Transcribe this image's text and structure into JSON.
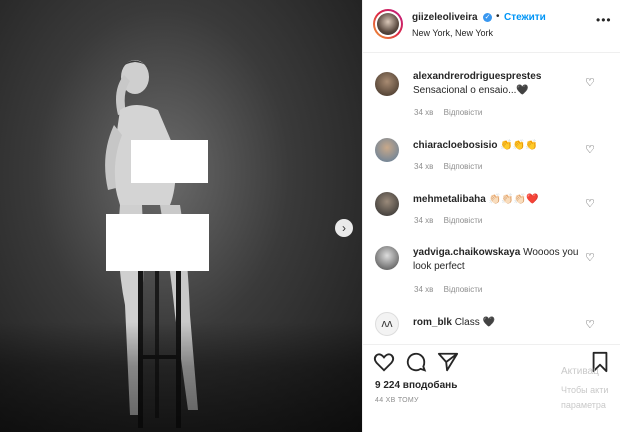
{
  "post": {
    "username": "giizeleoliveira",
    "follow_label": "Стежити",
    "location": "New York, New York",
    "more_label": "•••"
  },
  "comments": [
    {
      "username": "alexandrerodriguesprestes",
      "text": "Sensacional o ensaio...🖤",
      "time": "34 хв",
      "reply": "Відповісти"
    },
    {
      "username": "chiaracloebosisio",
      "text": "👏👏👏",
      "time": "34 хв",
      "reply": "Відповісти"
    },
    {
      "username": "mehmetalibaha",
      "text": "👏🏻👏🏻👏🏻❤️",
      "time": "34 хв",
      "reply": "Відповісти"
    },
    {
      "username": "yadviga.chaikowskaya",
      "text": "Woooos you look perfect",
      "time": "34 хв",
      "reply": "Відповісти"
    },
    {
      "username": "rom_blk",
      "text": "Class 🖤",
      "time": "",
      "reply": ""
    }
  ],
  "footer": {
    "likes": "9 224 вподобань",
    "timestamp": "44 ХВ ТОМУ"
  },
  "watermark": {
    "line1": "Активац",
    "line2": "Чтобы акти",
    "line3": "параметра"
  },
  "colors": {
    "accent": "#0095f6",
    "text": "#262626",
    "muted": "#8e8e8e",
    "border": "#efefef"
  }
}
